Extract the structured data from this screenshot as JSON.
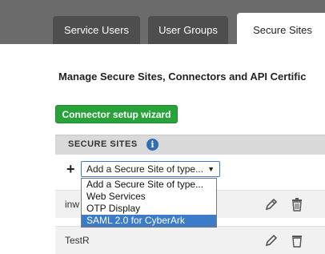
{
  "tabs": [
    {
      "label": "Service Users"
    },
    {
      "label": "User Groups"
    },
    {
      "label": "Secure Sites"
    }
  ],
  "heading": "Manage Secure Sites, Connectors and API Certific",
  "wizard_button": "Connector setup wizard",
  "panel": {
    "title": "SECURE SITES",
    "info_icon": "i"
  },
  "add": {
    "plus_icon": "+",
    "select_value": "Add a Secure Site of type...",
    "arrow": "▼",
    "options": [
      "Add a Secure Site of type...",
      "Web Services",
      "OTP Display",
      "SAML 2.0 for CyberArk"
    ]
  },
  "rows": [
    {
      "name": "inw"
    },
    {
      "name": "TestR"
    }
  ],
  "colors": {
    "topbar": "#6b6b6b",
    "tab": "#4e4e4e",
    "wizard": "#27a33a",
    "accent": "#3b7bc8"
  }
}
